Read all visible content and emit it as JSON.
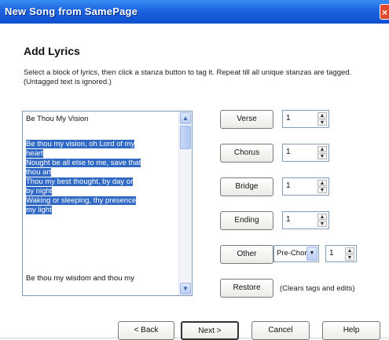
{
  "window": {
    "title": "New Song from SamePage",
    "close_glyph": "×"
  },
  "page": {
    "heading": "Add Lyrics",
    "instructions": "Select a block of lyrics, then click a stanza button to tag it. Repeat till all unique stanzas are tagged. (Untagged text is ignored.)"
  },
  "lyrics": {
    "first_line": "Be Thou My Vision",
    "selected_lines": [
      "Be thou my vision, oh Lord of my",
      "heart",
      "Nought be all else to me, save that",
      "thou art",
      "Thou my best thought, by day or",
      "by night",
      "Waking or sleeping, thy presence",
      "my light"
    ],
    "last_line": "Be thou my wisdom and thou my"
  },
  "stanzas": [
    {
      "label": "Verse",
      "count": "1"
    },
    {
      "label": "Chorus",
      "count": "1"
    },
    {
      "label": "Bridge",
      "count": "1"
    },
    {
      "label": "Ending",
      "count": "1"
    }
  ],
  "other": {
    "label": "Other",
    "type_value": "Pre-Chor",
    "count": "1"
  },
  "restore": {
    "label": "Restore",
    "note": "(Clears tags and edits)"
  },
  "footer": {
    "back": "< Back",
    "next": "Next >",
    "cancel": "Cancel",
    "help": "Help"
  }
}
